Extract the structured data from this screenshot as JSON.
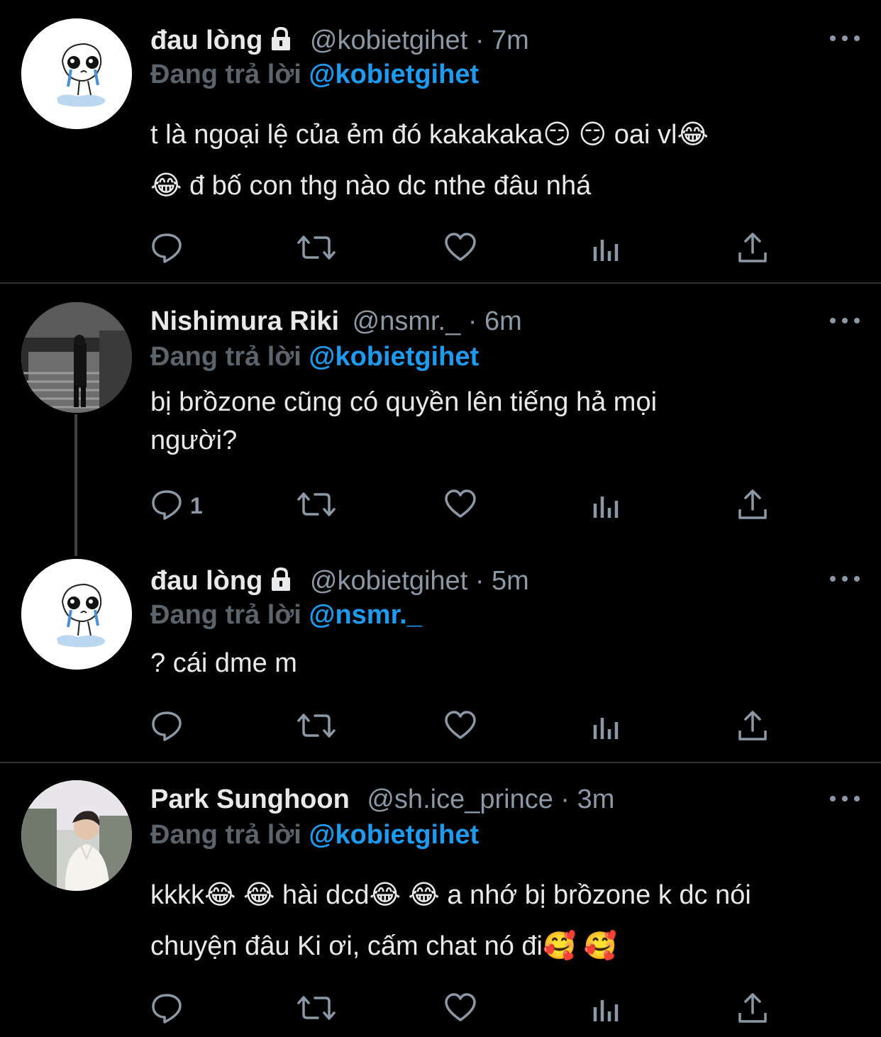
{
  "tweets": [
    {
      "name": "đau lòng",
      "locked": true,
      "handle": "@kobietgihet",
      "separator": "·",
      "time": "7m",
      "reply_prefix": "Đang trả lời",
      "reply_to": "@kobietgihet",
      "body_lines": [
        "t là ngoại lệ của ẻm đó kakakaka😏 😏  oai vl😂",
        "😂  đ bố con thg nào dc nthe đâu nhá"
      ],
      "reply_count": ""
    },
    {
      "name": "Nishimura Riki",
      "locked": false,
      "handle": "@nsmr._",
      "separator": "·",
      "time": "6m",
      "reply_prefix": "Đang trả lời",
      "reply_to": "@kobietgihet",
      "body_lines": [
        "bị brồzone cũng có quyền lên tiếng hả mọi",
        "người?"
      ],
      "reply_count": "1"
    },
    {
      "name": "đau lòng",
      "locked": true,
      "handle": "@kobietgihet",
      "separator": "·",
      "time": "5m",
      "reply_prefix": "Đang trả lời",
      "reply_to": "@nsmr._",
      "body_lines": [
        "? cái dme m"
      ],
      "reply_count": ""
    },
    {
      "name": "Park Sunghoon",
      "locked": false,
      "handle": "@sh.ice_prince",
      "separator": "·",
      "time": "3m",
      "reply_prefix": "Đang trả lời",
      "reply_to": "@kobietgihet",
      "body_lines": [
        "kkkk😂 😂 hài dcd😂 😂 a nhớ bị brồzone k dc nói",
        "chuyện đâu Ki ơi, cấm chat nó đi🥰 🥰"
      ],
      "reply_count": ""
    }
  ],
  "icons": {
    "reply": "reply-icon",
    "retweet": "retweet-icon",
    "like": "heart-icon",
    "views": "analytics-icon",
    "share": "share-icon",
    "more": "more-icon",
    "lock": "lock-icon"
  },
  "colors": {
    "background": "#000000",
    "text": "#e7e9ea",
    "secondary": "#8b98a5",
    "reply_prefix": "#5b636b",
    "mention": "#1d9bf0",
    "divider": "#2f3336"
  }
}
